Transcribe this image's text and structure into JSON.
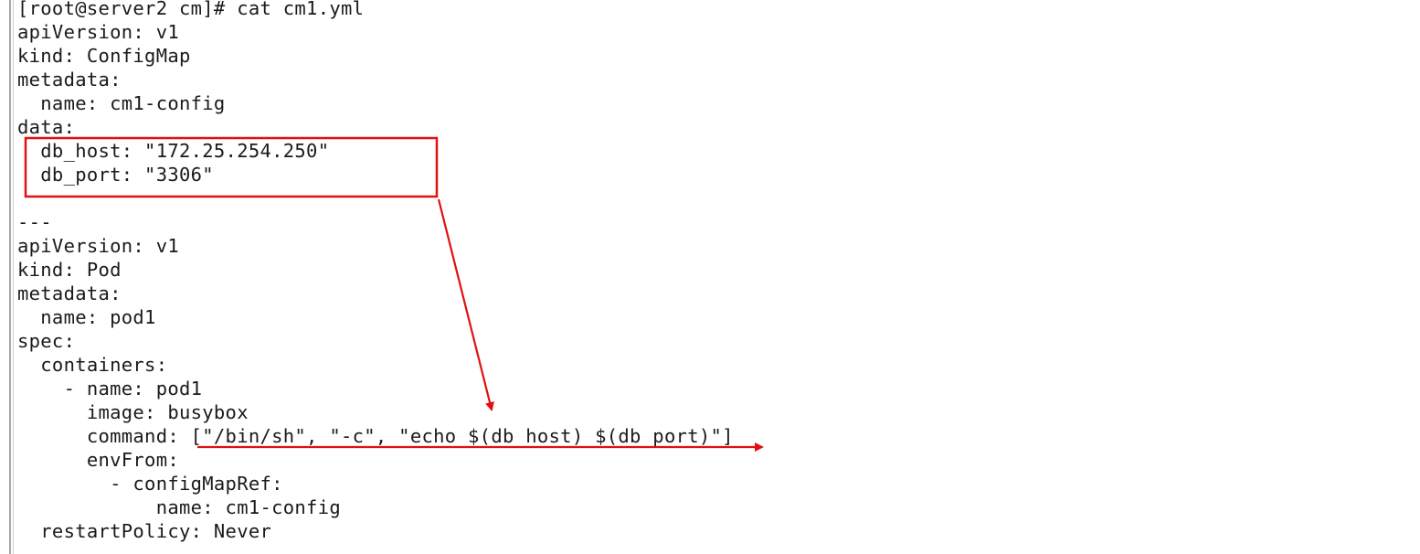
{
  "terminal": {
    "lines": [
      "[root@server2 cm]# cat cm1.yml",
      "apiVersion: v1",
      "kind: ConfigMap",
      "metadata:",
      "  name: cm1-config",
      "data:",
      "  db_host: \"172.25.254.250\"",
      "  db_port: \"3306\"",
      "",
      "---",
      "apiVersion: v1",
      "kind: Pod",
      "metadata:",
      "  name: pod1",
      "spec:",
      "  containers:",
      "    - name: pod1",
      "      image: busybox",
      "      command: [\"/bin/sh\", \"-c\", \"echo $(db_host) $(db_port)\"]",
      "      envFrom:",
      "        - configMapRef:",
      "            name: cm1-config",
      "  restartPolicy: Never"
    ]
  },
  "annotations": {
    "color": "#e01010"
  }
}
